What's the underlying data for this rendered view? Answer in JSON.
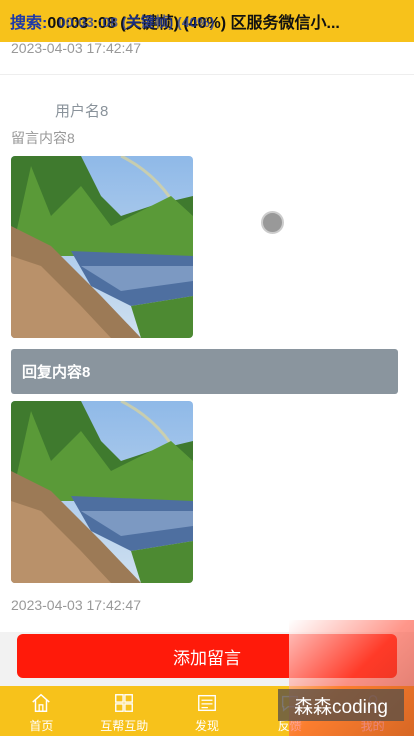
{
  "header": {
    "search_label": "搜索:",
    "title": "00:03 :08 (关键帧) (40%) 区服务微信小...",
    "overlay": "00:03 :08 (关键帧) (40%)"
  },
  "message": {
    "top_timestamp": "2023-04-03 17:42:47",
    "username": "用户名8",
    "content": "留言内容8",
    "reply": "回复内容8",
    "timestamp": "2023-04-03 17:42:47"
  },
  "actions": {
    "add_message": "添加留言"
  },
  "tabbar": {
    "items": [
      {
        "label": "首页",
        "icon": "home-icon"
      },
      {
        "label": "互帮互助",
        "icon": "help-icon"
      },
      {
        "label": "发现",
        "icon": "discover-icon"
      },
      {
        "label": "反馈",
        "icon": "feedback-icon"
      },
      {
        "label": "我的",
        "icon": "user-icon"
      }
    ]
  },
  "watermark": "森森coding"
}
